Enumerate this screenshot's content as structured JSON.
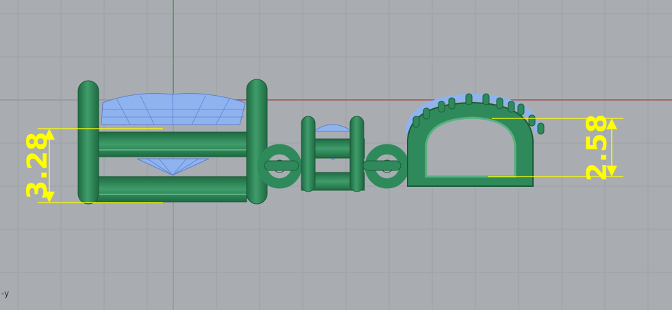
{
  "viewport": {
    "axis_label": "-y",
    "colors": {
      "background": "#a9adb2",
      "grid": "#9da1a6",
      "grid_major": "#93979c",
      "metal": "#2f8a5b",
      "metal_dark": "#1e6a42",
      "metal_light": "#57b07f",
      "gem": "#8fb3ef",
      "gem_wire": "#5e7fd0",
      "dimension": "#ffff00",
      "axis_x": "#b04040",
      "axis_y": "#2f9a3f"
    }
  },
  "dimensions": {
    "left": {
      "value": "3.28"
    },
    "right": {
      "value": "2.58"
    }
  }
}
